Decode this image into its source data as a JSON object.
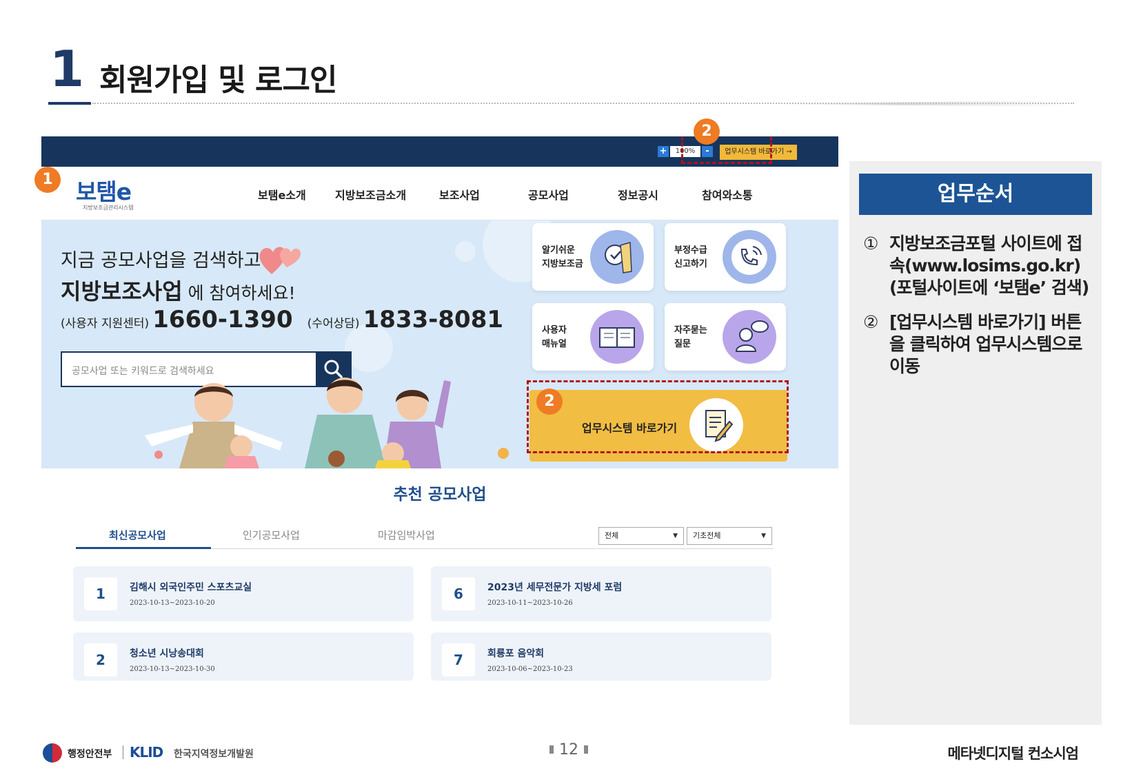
{
  "header": {
    "section_number": "1",
    "title": "회원가입 및 로그인"
  },
  "portal": {
    "topbar": {
      "zoom_plus": "+",
      "zoom_value": "100%",
      "zoom_minus": "-",
      "work_system_button": "업무시스템 바로가기 →"
    },
    "logo": {
      "text": "보탬e",
      "subtitle": "지방보조금관리시스템"
    },
    "menu": [
      "보탬e소개",
      "지방보조금소개",
      "보조사업",
      "공모사업",
      "정보공시",
      "참여와소통"
    ],
    "hero": {
      "line1": "지금 공모사업을 검색하고",
      "line2_bold": "지방보조사업",
      "line2_rest": " 에 참여하세요!",
      "support_label": "(사용자 지원센터)",
      "support_phone": "1660-1390",
      "sign_label": "(수어상담)",
      "sign_phone": "1833-8081",
      "search_placeholder": "공모사업 또는 키워드로 검색하세요"
    },
    "cards": [
      {
        "line1": "알기쉬운",
        "line2": "지방보조금"
      },
      {
        "line1": "부정수급",
        "line2": "신고하기"
      },
      {
        "line1": "사용자",
        "line2": "매뉴얼"
      },
      {
        "line1": "자주묻는",
        "line2": "질문"
      }
    ],
    "work_system_big": "업무시스템 바로가기",
    "badges": [
      "1",
      "2",
      "2"
    ],
    "recommend": {
      "title": "추천 공모사업",
      "tabs": [
        "최신공모사업",
        "인기공모사업",
        "마감임박사업"
      ],
      "select_region": "전체",
      "select_basic": "기초전체",
      "items": [
        {
          "num": "1",
          "title": "김해시 외국인주민 스포츠교실",
          "date": "2023-10-13~2023-10-20"
        },
        {
          "num": "6",
          "title": "2023년 세무전문가 지방세 포럼",
          "date": "2023-10-11~2023-10-26"
        },
        {
          "num": "2",
          "title": "청소년 시낭송대회",
          "date": "2023-10-13~2023-10-30"
        },
        {
          "num": "7",
          "title": "회룡포 음악회",
          "date": "2023-10-06~2023-10-23"
        }
      ]
    }
  },
  "panel": {
    "title": "업무순서",
    "steps": [
      {
        "mark": "①",
        "text": "지방보조금포털 사이트에 접속(www.losims.go.kr) (포털사이트에 ‘보탬e’ 검색)"
      },
      {
        "mark": "②",
        "text": "[업무시스템 바로가기] 버튼을 클릭하여 업무시스템으로 이동"
      }
    ]
  },
  "footer": {
    "gov": "행정안전부",
    "klid": "KLID",
    "klid_name": "한국지역정보개발원",
    "page": "12",
    "company": "메타넷디지털 컨소시엄"
  },
  "colors": {
    "navy": "#17355c",
    "accent_blue": "#1c5495",
    "badge_orange": "#ef7b24",
    "button_yellow": "#f1bd43",
    "dash_red": "#b0111e"
  }
}
